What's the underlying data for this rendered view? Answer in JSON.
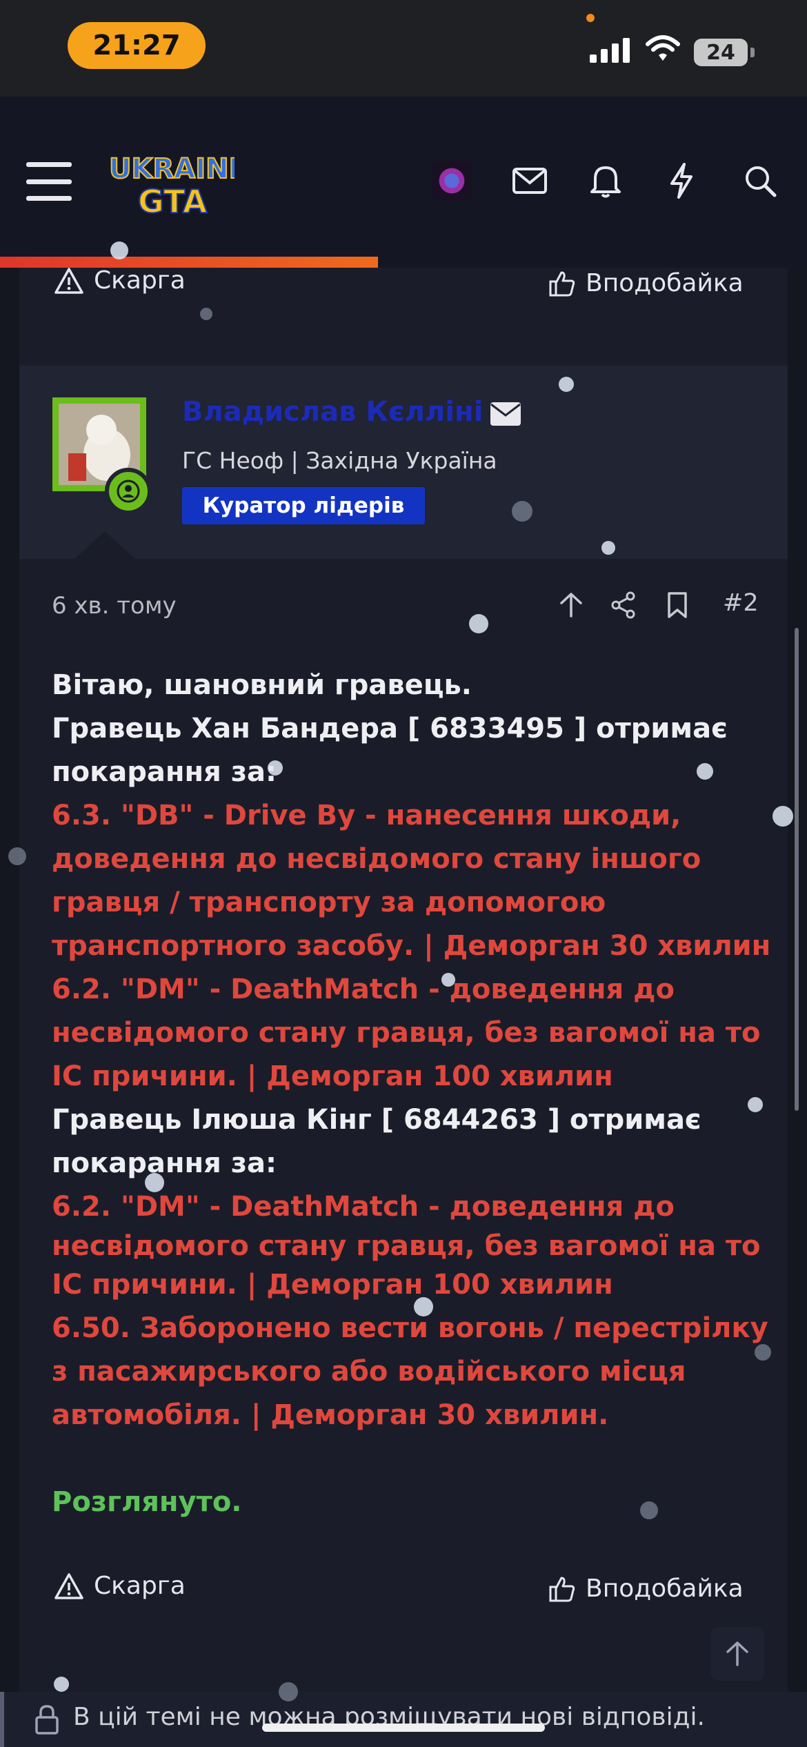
{
  "status_bar": {
    "time": "21:27",
    "battery": "24"
  },
  "header": {
    "menu_icon": "hamburger-icon",
    "logo_text_line1": "UKRAINE",
    "logo_text_line2": "GTA",
    "icons": [
      "avatar-icon",
      "mail-icon",
      "bell-icon",
      "lightning-icon",
      "search-icon"
    ],
    "accent": "#f06a1e"
  },
  "previous_post": {
    "report_label": "Скарга",
    "like_label": "Вподобайка"
  },
  "author": {
    "name": "Владислав Кєлліні",
    "title": "ГС Неоф | Західна Україна",
    "role_badge": "Куратор лідерів",
    "name_color": "#1b2bb8",
    "badge_color": "#1334c2"
  },
  "post_meta": {
    "time": "6 хв. тому",
    "number": "#2"
  },
  "post": {
    "l1": "Вітаю, шановний гравець.",
    "l2": "Гравець Хан Бандера [ 6833495 ] отримає",
    "l3": "покарання за:",
    "l4": "6.3. \"DB\" - Drive By - нанесення шкоди,",
    "l5": "доведення до несвідомого стану іншого",
    "l6": "гравця / транспорту за допомогою",
    "l7": "транспортного засобу. | Деморган 30 хвилин",
    "l8": "6.2. \"DM\" - DeathMatch - доведення до",
    "l9": "несвідомого стану гравця, без вагомої на то",
    "l10": "IC причини. | Деморган 100 хвилин",
    "l11": "Гравець Ілюша Кінг [ 6844263 ] отримає",
    "l12": "покарання за:",
    "l13": "6.2. \"DM\" - DeathMatch - доведення до",
    "l14": "несвідомого стану гравця, без вагомої на то",
    "l15": "IC причини. | Деморган 100 хвилин",
    "l16": "6.50. Заборонено вести вогонь / перестрілку",
    "l17": "з пасажирського або водійського місця",
    "l18": "автомобіля. | Деморган 30 хвилин.",
    "l19": "Розглянуто."
  },
  "post_actions": {
    "report_label": "Скарга",
    "like_label": "Вподобайка"
  },
  "footer": {
    "notice": "В цій темі не можна розміщувати нові відповіді."
  },
  "colors": {
    "penalty_text": "#e0473d",
    "status_text": "#5ec25a",
    "background": "#141620"
  }
}
